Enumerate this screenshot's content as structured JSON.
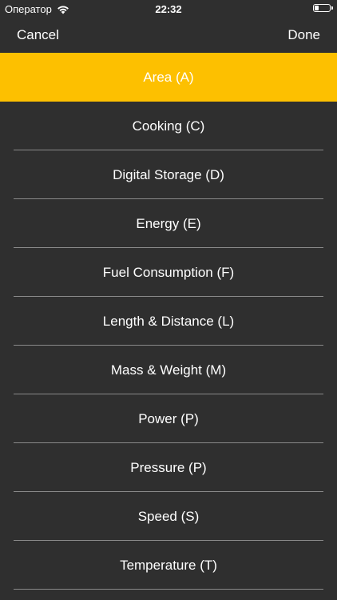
{
  "status_bar": {
    "carrier": "Оператор",
    "time": "22:32",
    "battery_level": 0.3
  },
  "nav": {
    "cancel_label": "Cancel",
    "done_label": "Done"
  },
  "categories": [
    {
      "label": "Area (A)",
      "selected": true
    },
    {
      "label": "Cooking (C)",
      "selected": false
    },
    {
      "label": "Digital Storage (D)",
      "selected": false
    },
    {
      "label": "Energy (E)",
      "selected": false
    },
    {
      "label": "Fuel Consumption (F)",
      "selected": false
    },
    {
      "label": "Length & Distance (L)",
      "selected": false
    },
    {
      "label": "Mass & Weight (M)",
      "selected": false
    },
    {
      "label": "Power (P)",
      "selected": false
    },
    {
      "label": "Pressure (P)",
      "selected": false
    },
    {
      "label": "Speed (S)",
      "selected": false
    },
    {
      "label": "Temperature (T)",
      "selected": false
    }
  ],
  "colors": {
    "background": "#2f2f2f",
    "selected": "#fdc000",
    "separator": "#8a8a8a",
    "text": "#ffffff"
  },
  "icons": {
    "wifi": "wifi-icon",
    "battery": "battery-icon"
  }
}
